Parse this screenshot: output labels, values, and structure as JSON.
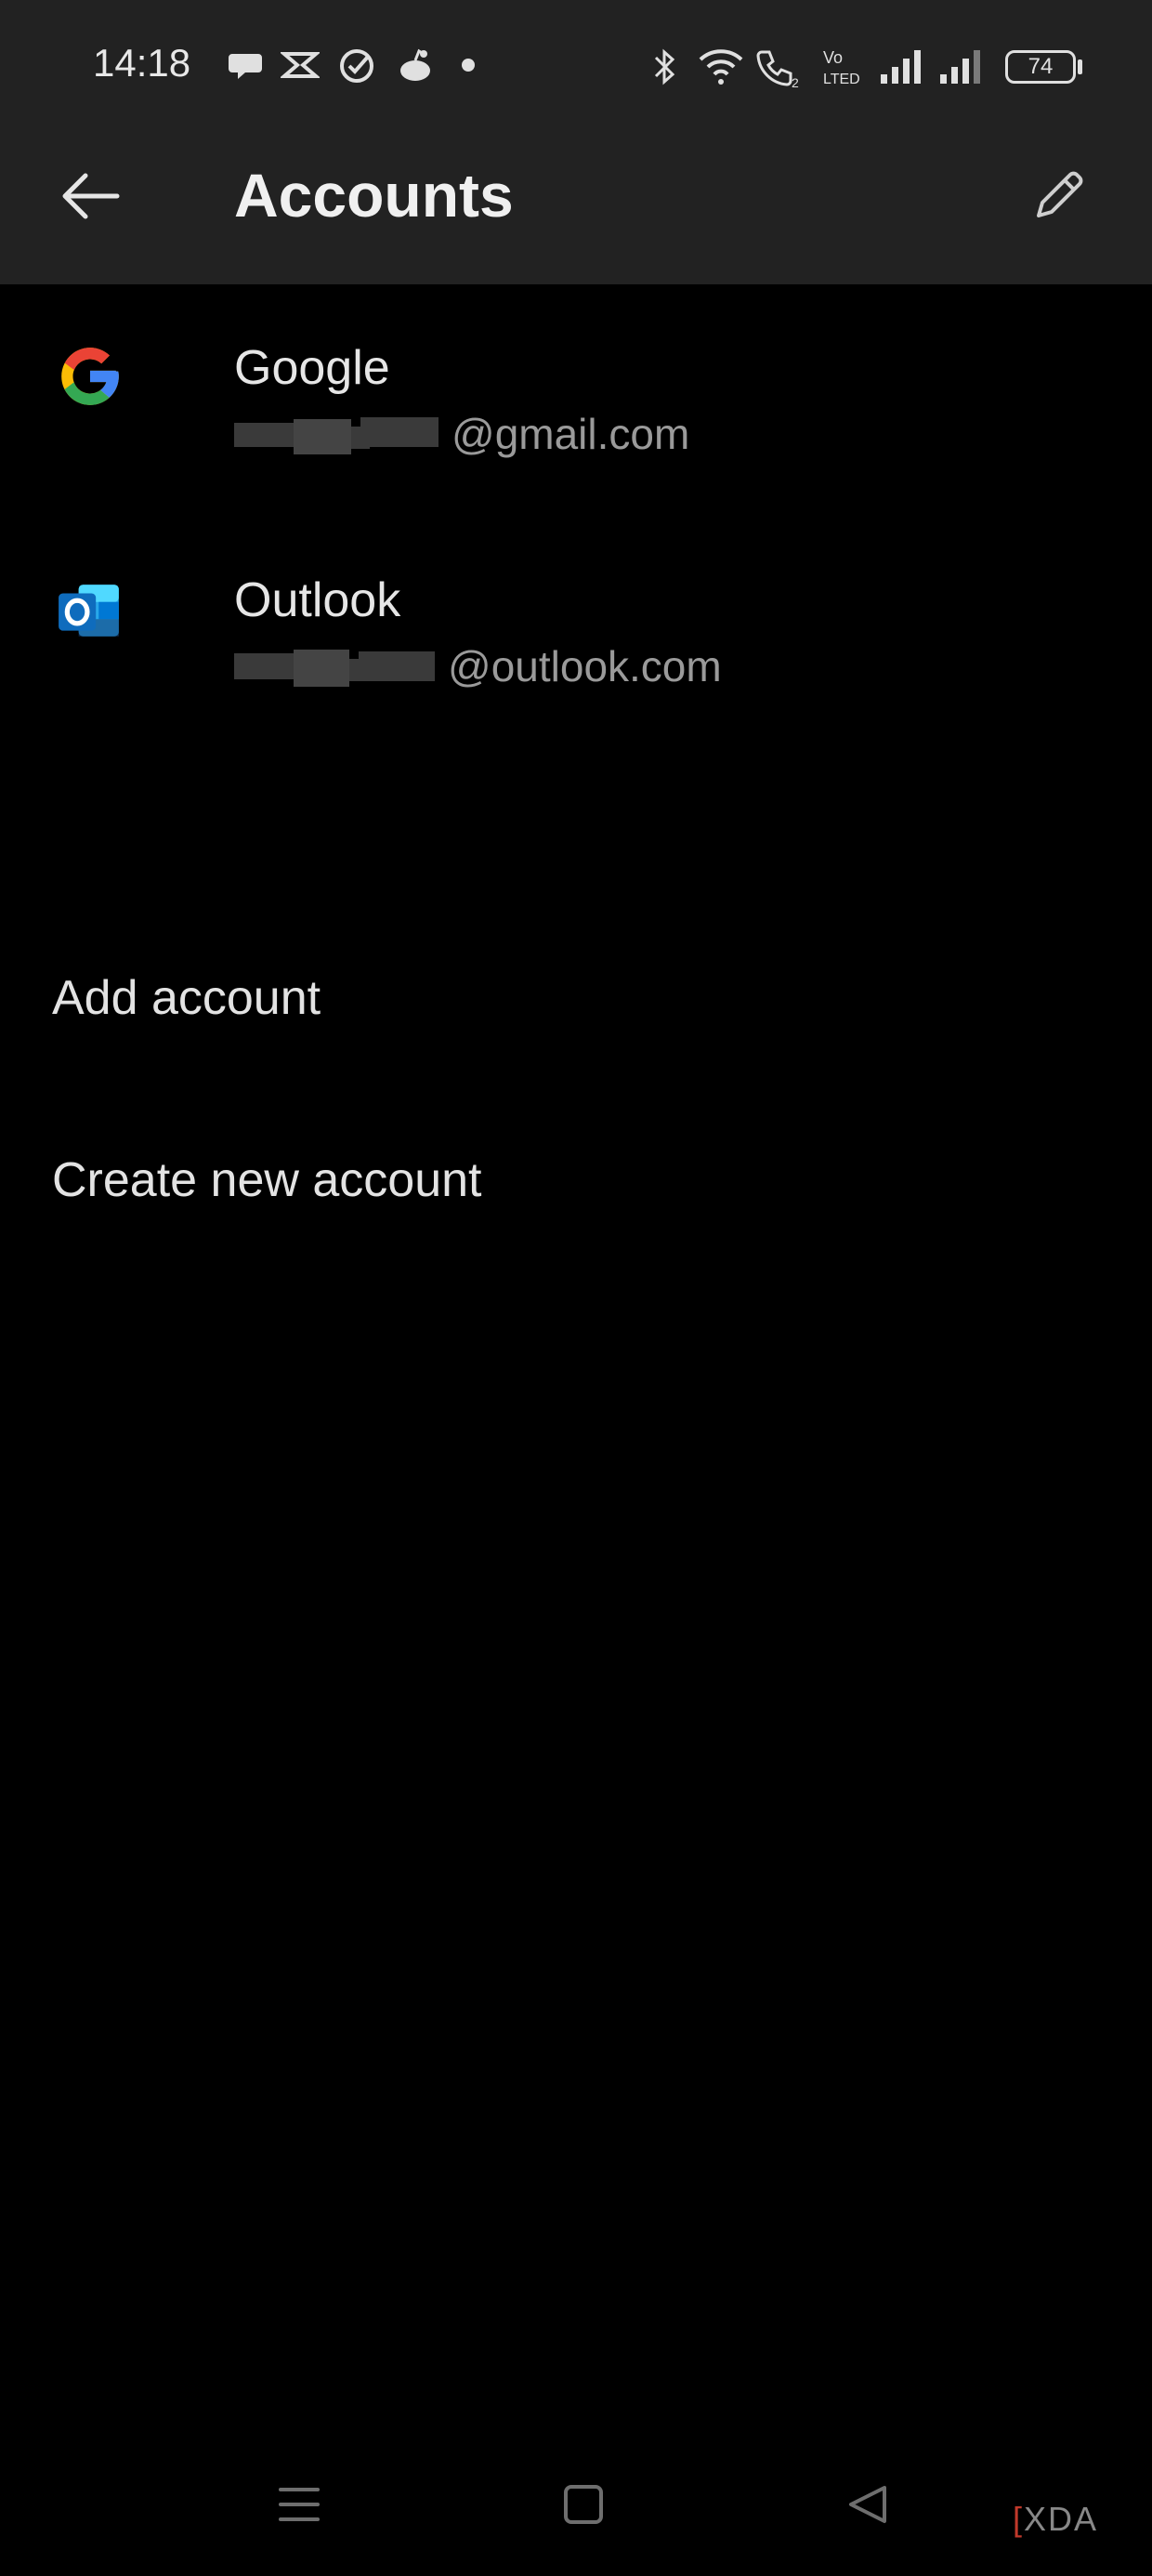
{
  "status_bar": {
    "time": "14:18",
    "battery": "74",
    "icons": [
      "chat-bubble-icon",
      "capcut-icon",
      "tasks-check-icon",
      "reddit-icon",
      "dot-icon",
      "bluetooth-icon",
      "wifi-icon",
      "wifi-call-icon",
      "volte-icon",
      "signal-icon",
      "signal-icon",
      "battery-icon"
    ]
  },
  "app_bar": {
    "title": "Accounts",
    "back_icon": "arrow-left-icon",
    "edit_icon": "pencil-icon"
  },
  "accounts": [
    {
      "name": "Google",
      "email_domain": "@gmail.com",
      "icon": "google-icon"
    },
    {
      "name": "Outlook",
      "email_domain": "@outlook.com",
      "icon": "outlook-icon"
    }
  ],
  "actions": {
    "add_account": "Add account",
    "create_new_account": "Create new account"
  },
  "nav_bar": {
    "icons": [
      "menu-icon",
      "home-square-icon",
      "back-triangle-icon"
    ]
  },
  "watermark": "XDA",
  "colors": {
    "bar_background": "#222222",
    "page_background": "#000000",
    "outlook_blue": "#0f6cbd",
    "google_blue": "#4285f4",
    "google_red": "#ea4335",
    "google_yellow": "#fbbc05",
    "google_green": "#34a853"
  }
}
